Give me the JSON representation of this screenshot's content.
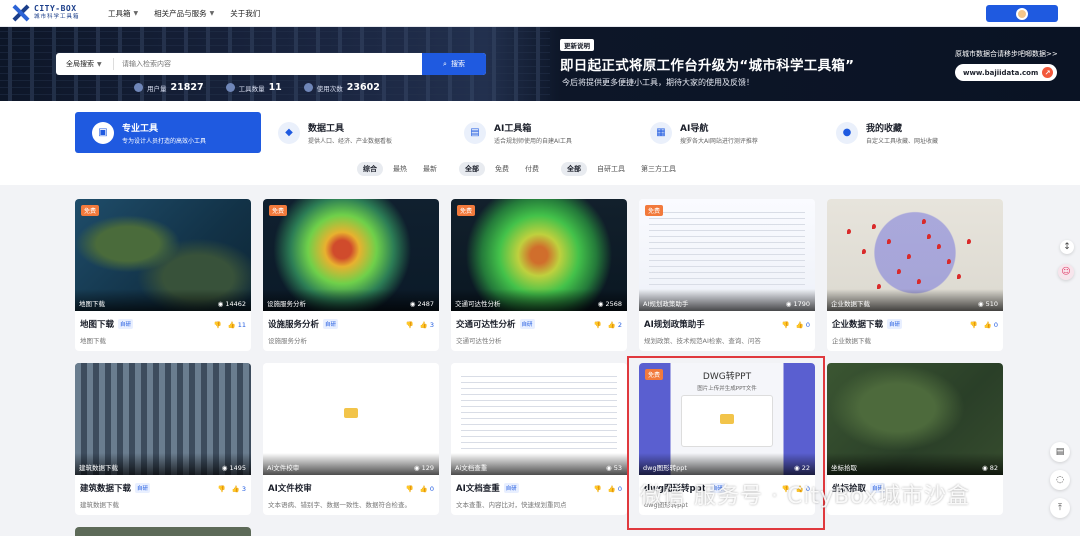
{
  "nav": {
    "logo_en": "CITY-BOX",
    "logo_cn": "城市科学工具箱",
    "items": [
      {
        "label": "工具箱",
        "caret": true
      },
      {
        "label": "相关产品与服务",
        "caret": true
      },
      {
        "label": "关于我们",
        "caret": false
      }
    ]
  },
  "hero": {
    "search": {
      "scope": "全局搜索",
      "placeholder": "请输入检索内容",
      "button": "搜索"
    },
    "stats": [
      {
        "label": "用户量",
        "value": "21827"
      },
      {
        "label": "工具数量",
        "value": "11"
      },
      {
        "label": "使用次数",
        "value": "23602"
      }
    ],
    "announcement": {
      "tag": "更新说明",
      "title": "即日起正式将原工作台升级为“城市科学工具箱”",
      "subtitle": "今后将提供更多便捷小工具，期待大家的使用及反馈！",
      "right_text": "原城市数据合请移步吧唧数据>>",
      "link": "www.bajiidata.com",
      "link_arrow": "↗"
    }
  },
  "categories": [
    {
      "name": "专业工具",
      "desc": "专为设计人员打造的高效小工具",
      "icon": "toolbox-icon",
      "glyph": "▣"
    },
    {
      "name": "数据工具",
      "desc": "提供人口、经济、产业数据看板",
      "icon": "data-cubes-icon",
      "glyph": "◆"
    },
    {
      "name": "AI工具箱",
      "desc": "适合规划师使用的自建AI工具",
      "icon": "ai-toolbox-icon",
      "glyph": "▤"
    },
    {
      "name": "AI导航",
      "desc": "搜罗各大AI网站进行测评推荐",
      "icon": "grid-icon",
      "glyph": "▦"
    },
    {
      "name": "我的收藏",
      "desc": "自定义工具收藏、网址收藏",
      "icon": "user-icon",
      "glyph": "●"
    }
  ],
  "filters": [
    {
      "options": [
        "综合",
        "最热",
        "最新"
      ],
      "selected": 0
    },
    {
      "options": [
        "全部",
        "免费",
        "付费"
      ],
      "selected": 0
    },
    {
      "options": [
        "全部",
        "自研工具",
        "第三方工具"
      ],
      "selected": 0
    }
  ],
  "cards": [
    {
      "title": "地图下载",
      "tag": "自研",
      "desc": "地图下载",
      "label": "地图下载",
      "views": "14462",
      "free": "免费",
      "down": "",
      "up": "11",
      "theme": "t-map1"
    },
    {
      "title": "设施服务分析",
      "tag": "自研",
      "desc": "设施服务分析",
      "label": "设施服务分析",
      "views": "2487",
      "free": "免费",
      "down": "",
      "up": "3",
      "theme": "t-heat"
    },
    {
      "title": "交通可达性分析",
      "tag": "自研",
      "desc": "交通可达性分析",
      "label": "交通可达性分析",
      "views": "2568",
      "free": "免费",
      "down": "",
      "up": "2",
      "theme": "t-heat2"
    },
    {
      "title": "AI规划政策助手",
      "tag": "",
      "desc": "规划政策、技术规范AI检索、查询、问答",
      "label": "AI规划政策助手",
      "views": "1790",
      "free": "免费",
      "down": "",
      "up": "0",
      "theme": "t-doc"
    },
    {
      "title": "企业数据下载",
      "tag": "自研",
      "desc": "企业数据下载",
      "label": "企业数据下载",
      "views": "510",
      "free": "",
      "down": "",
      "up": "0",
      "theme": "t-pins"
    },
    {
      "title": "建筑数据下载",
      "tag": "自研",
      "desc": "建筑数据下载",
      "label": "建筑数据下载",
      "views": "1495",
      "free": "",
      "down": "",
      "up": "3",
      "theme": "t-build"
    },
    {
      "title": "AI文件校审",
      "tag": "",
      "desc": "文本语病、错别字、数据一致性、数据符合检查。",
      "label": "Ai文件校审",
      "views": "129",
      "free": "",
      "down": "",
      "up": "0",
      "theme": "t-ai"
    },
    {
      "title": "AI文档查重",
      "tag": "自研",
      "desc": "文本查重、内容比对，快速规划重同点",
      "label": "Ai文档查重",
      "views": "53",
      "free": "",
      "down": "",
      "up": "0",
      "theme": "t-text"
    },
    {
      "title": "dwg图形转ppt",
      "tag": "自研",
      "desc": "dwg图形转ppt",
      "label": "dwg图形转ppt",
      "views": "22",
      "free": "免费",
      "down": "",
      "up": "0",
      "theme": "t-ppt",
      "ppt_title": "DWG转PPT",
      "ppt_sub": "图片上传并生成PPT文件"
    },
    {
      "title": "坐标拾取",
      "tag": "自研",
      "desc": "",
      "label": "坐标拾取",
      "views": "82",
      "free": "",
      "down": "",
      "up": "",
      "theme": "t-sat"
    }
  ],
  "watermark": "微信 服务号 · CityBox城市沙盒",
  "colors": {
    "accent": "#1f5ae0",
    "free_badge": "#f27a3c",
    "highlight": "#e0393e"
  }
}
